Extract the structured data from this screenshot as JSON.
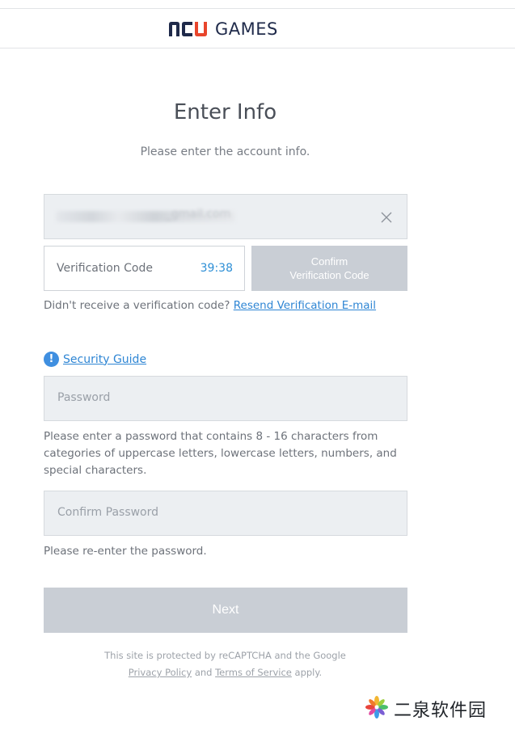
{
  "header": {
    "logo_text": "GAMES"
  },
  "page": {
    "title": "Enter Info",
    "subtitle": "Please enter the account info."
  },
  "email_field": {
    "value": "_gmail.com"
  },
  "verification": {
    "placeholder": "Verification Code",
    "timer": "39:38",
    "confirm_label_line1": "Confirm",
    "confirm_label_line2": "Verification Code",
    "not_received_text": "Didn't receive a verification code?",
    "resend_link": "Resend Verification E-mail"
  },
  "security_guide": {
    "label": "Security Guide",
    "icon": "info-icon"
  },
  "password": {
    "placeholder": "Password",
    "hint": "Please enter a password that contains 8 - 16 characters from categories of uppercase letters, lowercase letters, numbers, and special characters."
  },
  "confirm_password": {
    "placeholder": "Confirm Password",
    "hint": "Please re-enter the password."
  },
  "next_button": {
    "label": "Next"
  },
  "footer": {
    "line1": "This site is protected by reCAPTCHA and the Google",
    "privacy_link": "Privacy Policy",
    "and_text": "and",
    "terms_link": "Terms of Service",
    "apply_text": "apply."
  },
  "watermark": {
    "text": "二泉软件园"
  },
  "colors": {
    "accent": "#2f86d4",
    "disabled_button": "#c9ced5",
    "field_bg": "#eceff2"
  }
}
